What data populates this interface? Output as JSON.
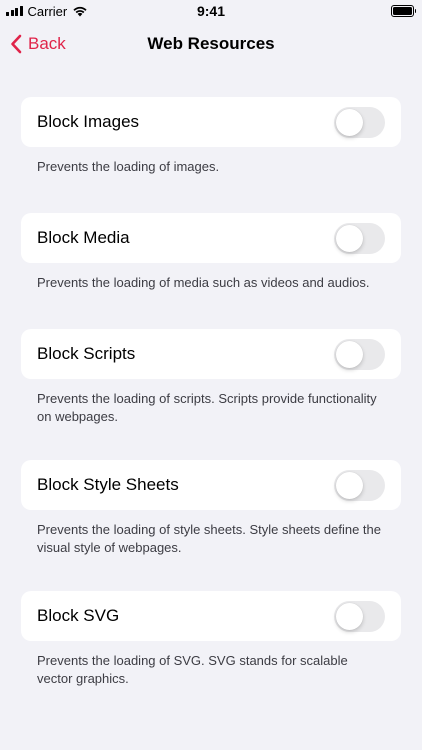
{
  "status_bar": {
    "carrier": "Carrier",
    "time": "9:41"
  },
  "nav": {
    "back_label": "Back",
    "title": "Web Resources"
  },
  "colors": {
    "accent": "#e0244a",
    "background": "#f2f2f7",
    "toggle_off": "#e9e9eb"
  },
  "settings": [
    {
      "label": "Block Images",
      "enabled": false,
      "description": "Prevents the loading of images."
    },
    {
      "label": "Block Media",
      "enabled": false,
      "description": "Prevents the loading of media such as videos and audios."
    },
    {
      "label": "Block Scripts",
      "enabled": false,
      "description": "Prevents the loading of scripts. Scripts provide functionality on webpages."
    },
    {
      "label": "Block Style Sheets",
      "enabled": false,
      "description": "Prevents the loading of style sheets. Style sheets define the visual style of webpages."
    },
    {
      "label": "Block SVG",
      "enabled": false,
      "description": "Prevents the loading of SVG. SVG stands for scalable vector graphics."
    }
  ]
}
